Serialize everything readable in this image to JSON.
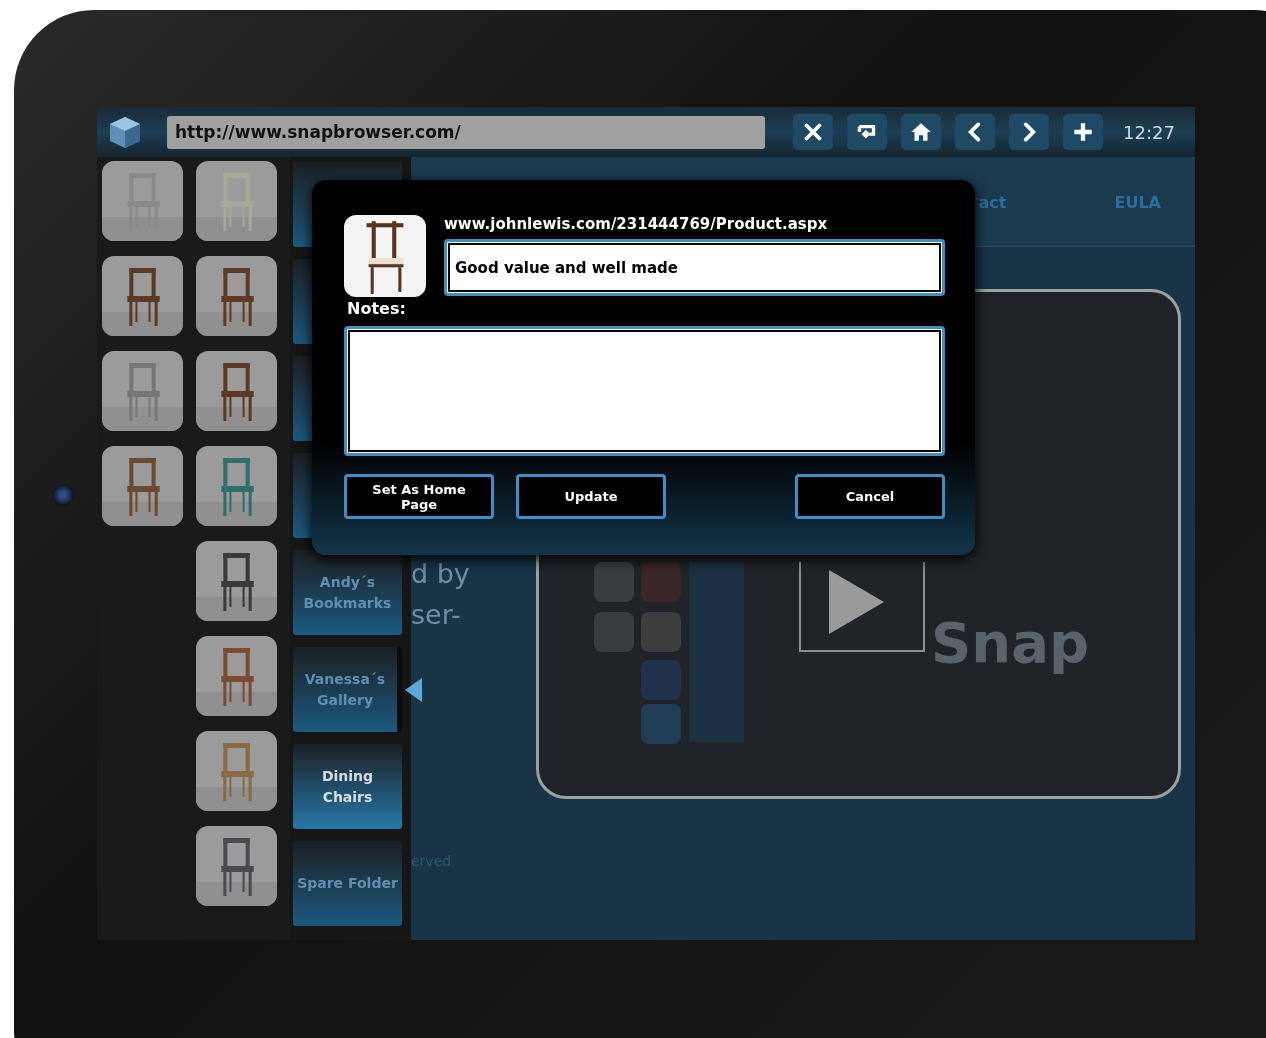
{
  "toolbar": {
    "url": "http://www.snapbrowser.com/",
    "buttons": [
      {
        "kind": "close"
      },
      {
        "kind": "return"
      },
      {
        "kind": "home"
      },
      {
        "kind": "back"
      },
      {
        "kind": "forward"
      },
      {
        "kind": "add"
      }
    ],
    "time": "12:27"
  },
  "folders": [
    {
      "selected": false
    },
    {
      "selected": false
    },
    {
      "selected": false
    },
    {
      "selected": false
    },
    {
      "label": "Andy´s Bookmarks",
      "selected": false,
      "arrow": false
    },
    {
      "label": "Vanessa´s Gallery",
      "selected": false,
      "arrow": true
    },
    {
      "label": "Dining Chairs",
      "selected": true,
      "arrow": false
    },
    {
      "label": "Spare Folder",
      "selected": false,
      "arrow": false
    }
  ],
  "page": {
    "nav": [
      "act",
      "EULA"
    ],
    "text_lines": [
      "d by",
      "ser-"
    ],
    "footer": "erved",
    "logo": "Snap"
  },
  "dialog": {
    "url": "www.johnlewis.com/231444769/Product.aspx",
    "title_value": "Good value and well made",
    "notes_label": "Notes:",
    "buttons": [
      "Set As Home Page",
      "Update",
      "Cancel"
    ]
  }
}
